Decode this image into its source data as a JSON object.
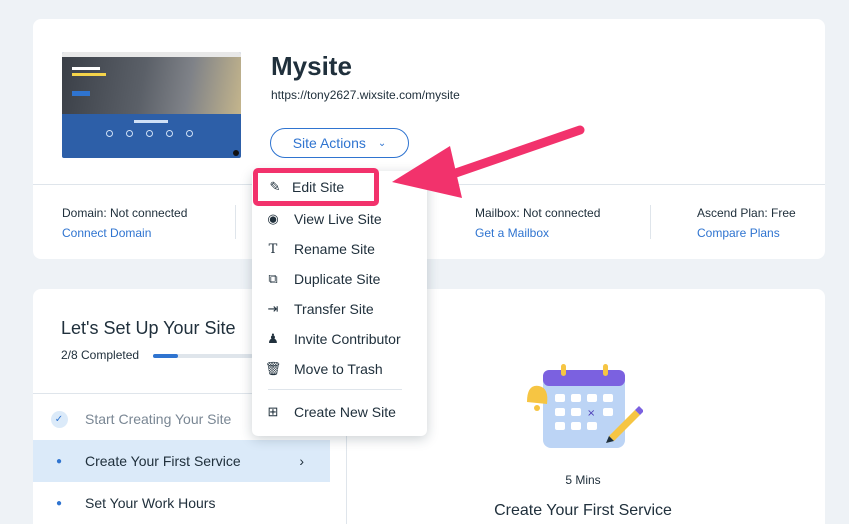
{
  "site": {
    "name": "Mysite",
    "url": "https://tony2627.wixsite.com/mysite",
    "actions_label": "Site Actions",
    "thumbnail_label": "OUR SERVICES"
  },
  "info": [
    {
      "label": "Domain: Not connected",
      "action": "Connect Domain"
    },
    {
      "label": "Mailbox: Not connected",
      "action": "Get a Mailbox"
    },
    {
      "label": "Ascend Plan: Free",
      "action": "Compare Plans"
    }
  ],
  "setup": {
    "title": "Let's Set Up Your Site",
    "progress_text": "2/8 Completed",
    "progress_fraction": 0.25,
    "steps": [
      {
        "label": "Start Creating Your Site",
        "state": "done"
      },
      {
        "label": "Create Your First Service",
        "state": "active"
      },
      {
        "label": "Set Your Work Hours",
        "state": "todo"
      }
    ],
    "detail": {
      "duration": "5 Mins",
      "title": "Create Your First Service"
    }
  },
  "menu": {
    "items": [
      {
        "label": "Edit Site",
        "icon": "pencil-icon"
      },
      {
        "label": "View Live Site",
        "icon": "eye-icon"
      },
      {
        "label": "Rename Site",
        "icon": "text-icon"
      },
      {
        "label": "Duplicate Site",
        "icon": "duplicate-icon"
      },
      {
        "label": "Transfer Site",
        "icon": "transfer-icon"
      },
      {
        "label": "Invite Contributor",
        "icon": "add-user-icon"
      },
      {
        "label": "Move to Trash",
        "icon": "trash-icon"
      },
      {
        "label": "Create New Site",
        "icon": "new-site-icon"
      }
    ]
  },
  "colors": {
    "accent": "#2f74d0",
    "highlight": "#f2326c",
    "background": "#eef2f6"
  }
}
